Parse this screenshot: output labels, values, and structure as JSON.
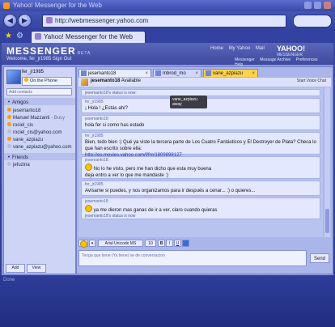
{
  "browser": {
    "title": "Yahoo! Messenger for the Web",
    "url": "http://webmessenger.yahoo.com",
    "tab_label": "Yahoo! Messenger for the Web"
  },
  "app": {
    "logo": "MESSENGER",
    "logo_badge": "BETA",
    "user_line": "Welcome, fer_jr1985    Sign Out",
    "top_links": [
      "Home",
      "My Yahoo",
      "Mail"
    ],
    "yahoo_brand": "YAHOO!",
    "yahoo_sub": "MESSENGER",
    "header_actions": [
      "Messenger",
      "Message Archive",
      "Preferences",
      "Help"
    ]
  },
  "sidebar": {
    "my_name": "fer_jr1985",
    "my_status": "On the Phone",
    "search_placeholder": "Add contacts",
    "group_friends": "Amigos",
    "contacts": [
      {
        "name": "jesemanto18",
        "sub": "",
        "color": "#f0a010"
      },
      {
        "name": "Manuel Mazzanti",
        "sub": " - Busy",
        "color": "#f0a010"
      },
      {
        "name": "rociel_cis",
        "sub": "",
        "color": "#f0a010"
      },
      {
        "name": "rociel_cis@yahoo.com",
        "sub": "",
        "color": "#b8c0e0"
      },
      {
        "name": "vane_azpiazu",
        "sub": "",
        "color": "#f0a010"
      },
      {
        "name": "vane_azpiazu@yahoo.com",
        "sub": "",
        "color": "#b8c0e0"
      }
    ],
    "group_friends2": "Friends",
    "friends": [
      {
        "name": "jefuzina",
        "color": "#b8c0e0"
      }
    ],
    "btn_add": "Add",
    "btn_view": "View"
  },
  "conversation": {
    "tabs": [
      {
        "label": "jesemanto18",
        "color": "#e7ecff"
      },
      {
        "label": "mbrod_mo",
        "color": "#d0d7fb"
      },
      {
        "label": "vane_azpiazu",
        "color": "#ffd24a"
      }
    ],
    "tooltip_name": "vane_azpiazu",
    "tooltip_status": "away",
    "header_name": "jesemanto18",
    "header_status": "Available",
    "header_link": "Start Voice Chat",
    "messages": [
      {
        "type": "status",
        "text": "jesemanto18's status is now:"
      },
      {
        "type": "msg",
        "from": "fer_jr1985",
        "text": "¡ Hola ! ¿Estás ahí?"
      },
      {
        "type": "msg",
        "from": "jesemanto18",
        "text": "hola fer si como has estado"
      },
      {
        "type": "msg",
        "from": "fer_jr1985",
        "text": "Bien, todo bien :) Qué ya viste la tercera parte de Los Cuatro Fantásticos y El Destroyer de Plata? Checa lo que han escrito sobre ella:",
        "link": "http://es.movies.yahoo.com/f/fm/1809898127"
      },
      {
        "type": "msg",
        "from": "jesemanto18",
        "text": "No lo he visto, pero me han dicho que esta muy buena",
        "text2": "deja entro a ver lo que me mandaste :)"
      },
      {
        "type": "msg",
        "from": "fer_jr1985",
        "text": "Avísame si puedes, y nos organizamos para ir después a cenar... :) o quieres..."
      },
      {
        "type": "msg",
        "from": "jesemanto18",
        "text": "ya me dieron mas ganas de ir a ver, claro cuando quieras",
        "status": "jesemanto18's status is now"
      }
    ],
    "toolbar_font": "Arial Unicode MS",
    "toolbar_size": "10",
    "input_placeholder": "Tenga que tiene (Ya tiene) se de conversacion",
    "send_label": "Send"
  },
  "statusbar": {
    "text": "Done"
  }
}
